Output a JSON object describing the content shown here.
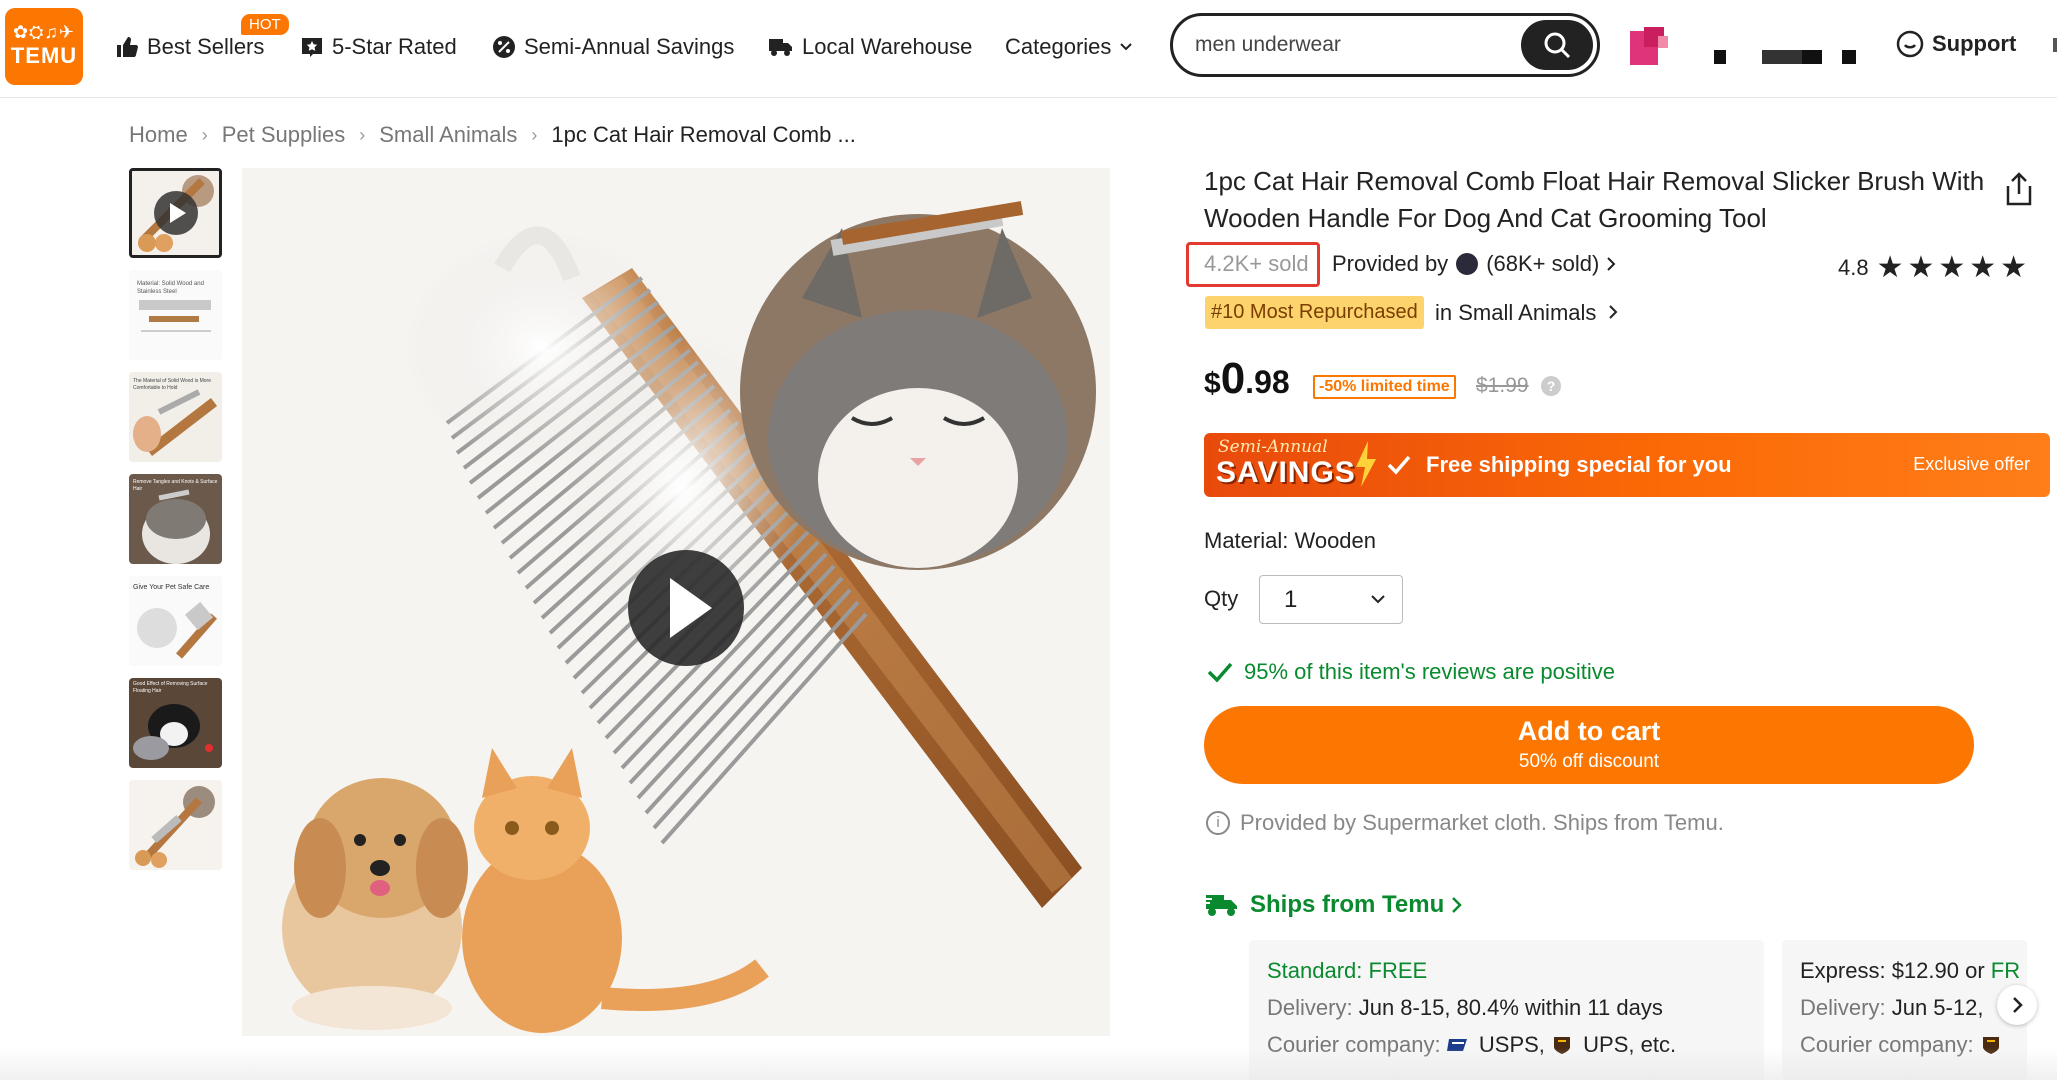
{
  "nav": {
    "logo_text": "TEMU",
    "best_sellers": "Best Sellers",
    "hot_badge": "HOT",
    "five_star": "5-Star Rated",
    "semi_annual": "Semi-Annual Savings",
    "local_warehouse": "Local Warehouse",
    "categories": "Categories",
    "search_value": "men underwear",
    "support": "Support"
  },
  "breadcrumb": [
    "Home",
    "Pet Supplies",
    "Small Animals",
    "1pc Cat Hair Removal Comb ..."
  ],
  "thumbnails": [
    {
      "caption": ""
    },
    {
      "caption": "Material: Solid Wood and Stainless Steel"
    },
    {
      "caption": "The Material of Solid Wood is More Comfortable to Hold"
    },
    {
      "caption": "Remove Tangles and Knots & Surface Hair"
    },
    {
      "caption": "Give Your Pet Safe Care"
    },
    {
      "caption": "Good Effect of Removing Surface Floating Hair"
    },
    {
      "caption": ""
    }
  ],
  "product": {
    "title": "1pc Cat Hair Removal Comb Float Hair Removal Slicker Brush With Wooden Handle For Dog And Cat Grooming Tool",
    "sold": "4.2K+ sold",
    "provided_by": "Provided by",
    "seller_sold": "(68K+ sold)",
    "rating": "4.8",
    "stars": "★★★★★",
    "rank_badge": "#10 Most Repurchased",
    "rank_category": "in Small Animals",
    "price_currency": "$",
    "price_whole": "0",
    "price_cents": ".98",
    "discount_tag": "-50% limited time",
    "original_price": "$1.99",
    "promo_line1": "Semi-Annual",
    "promo_line2": "SAVINGS",
    "promo_text": "Free shipping special for you",
    "promo_right": "Exclusive offer",
    "material": "Material: Wooden",
    "qty_label": "Qty",
    "qty_value": "1",
    "reviews_positive": "95% of this item's reviews are positive",
    "add_to_cart": "Add to cart",
    "add_to_cart_sub": "50% off discount",
    "provided_info": "Provided by Supermarket cloth. Ships from Temu.",
    "ships_from": "Ships from Temu"
  },
  "shipping": {
    "standard": {
      "title": "Standard: FREE",
      "delivery_label": "Delivery:",
      "delivery": "Jun 8-15, 80.4% within 11 days",
      "courier_label": "Courier company:",
      "courier_usps": "USPS,",
      "courier_ups": "UPS, etc."
    },
    "express": {
      "title_prefix": "Express: $12.90 or ",
      "title_free": "FR",
      "delivery_label": "Delivery:",
      "delivery": "Jun 5-12,",
      "courier_label": "Courier company:"
    }
  },
  "colors": {
    "brand_orange": "#fb7701",
    "green": "#0a8a2e",
    "highlight_red": "#e23a2e",
    "badge_yellow": "#fdd36e"
  }
}
